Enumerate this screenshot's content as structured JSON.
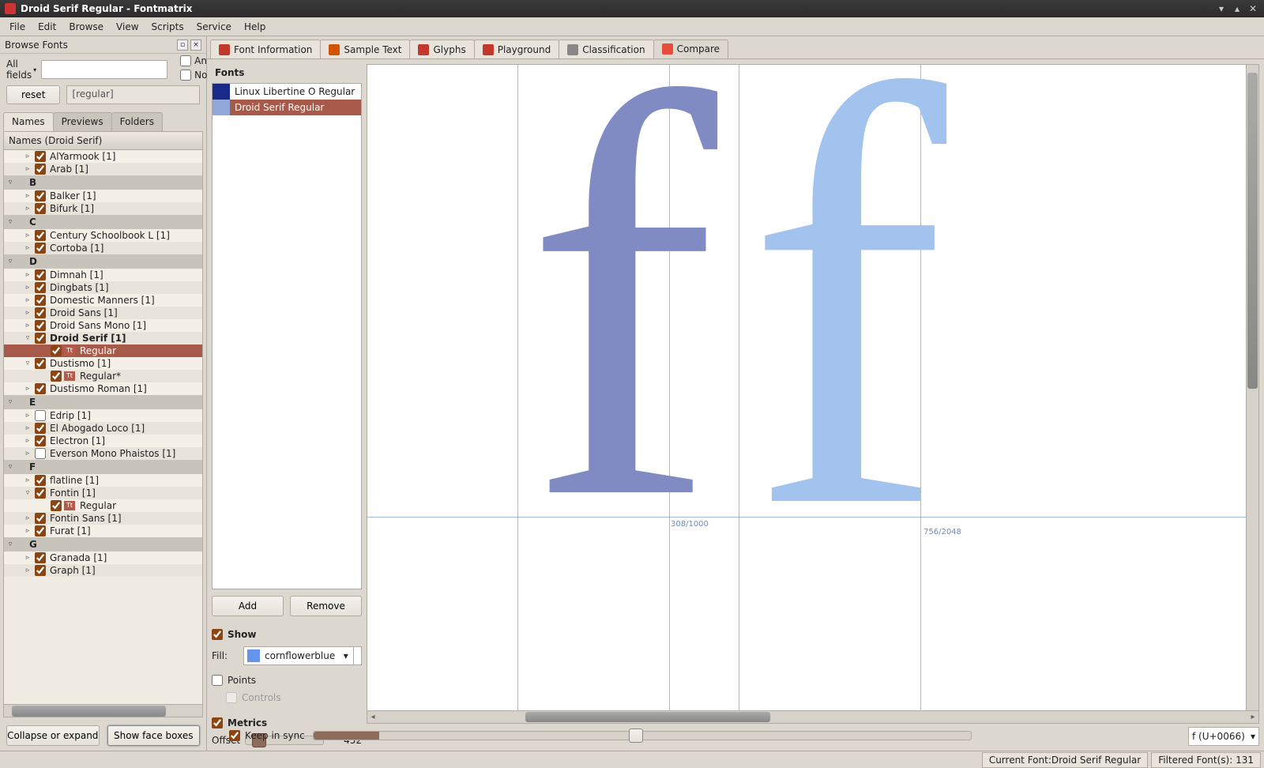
{
  "window": {
    "title": "Droid Serif Regular - Fontmatrix"
  },
  "menubar": [
    "File",
    "Edit",
    "Browse",
    "View",
    "Scripts",
    "Service",
    "Help"
  ],
  "browse": {
    "header": "Browse Fonts",
    "search_label": "All fields",
    "and": "And",
    "not": "Not",
    "reset": "reset",
    "filter_expr": "[regular]"
  },
  "sidetabs": {
    "names": "Names",
    "previews": "Previews",
    "folders": "Folders"
  },
  "tree": {
    "header": "Names (Droid Serif)",
    "rows": [
      {
        "t": "item",
        "i": 1,
        "cb": true,
        "label": "AlYarmook  [1]",
        "exp": "▹"
      },
      {
        "t": "item",
        "i": 1,
        "cb": true,
        "label": "Arab  [1]",
        "exp": "▹"
      },
      {
        "t": "group",
        "letter": "B"
      },
      {
        "t": "item",
        "i": 1,
        "cb": true,
        "label": "Balker  [1]",
        "exp": "▹"
      },
      {
        "t": "item",
        "i": 1,
        "cb": true,
        "label": "Bifurk  [1]",
        "exp": "▹"
      },
      {
        "t": "group",
        "letter": "C"
      },
      {
        "t": "item",
        "i": 1,
        "cb": true,
        "label": "Century Schoolbook L  [1]",
        "exp": "▹"
      },
      {
        "t": "item",
        "i": 1,
        "cb": true,
        "label": "Cortoba  [1]",
        "exp": "▹"
      },
      {
        "t": "group",
        "letter": "D"
      },
      {
        "t": "item",
        "i": 1,
        "cb": true,
        "label": "Dimnah  [1]",
        "exp": "▹"
      },
      {
        "t": "item",
        "i": 1,
        "cb": true,
        "label": "Dingbats  [1]",
        "exp": "▹"
      },
      {
        "t": "item",
        "i": 1,
        "cb": true,
        "label": "Domestic Manners  [1]",
        "exp": "▹"
      },
      {
        "t": "item",
        "i": 1,
        "cb": true,
        "label": "Droid Sans  [1]",
        "exp": "▹"
      },
      {
        "t": "item",
        "i": 1,
        "cb": true,
        "label": "Droid Sans Mono  [1]",
        "exp": "▹"
      },
      {
        "t": "item",
        "i": 1,
        "cb": true,
        "label": "Droid Serif  [1]",
        "exp": "▿",
        "bold": true
      },
      {
        "t": "face",
        "i": 2,
        "cb": true,
        "label": "Regular",
        "tt": true,
        "sel": true
      },
      {
        "t": "item",
        "i": 1,
        "cb": true,
        "label": "Dustismo  [1]",
        "exp": "▿"
      },
      {
        "t": "face",
        "i": 2,
        "cb": true,
        "label": "Regular*",
        "tt": true
      },
      {
        "t": "item",
        "i": 1,
        "cb": true,
        "label": "Dustismo Roman  [1]",
        "exp": "▹"
      },
      {
        "t": "group",
        "letter": "E"
      },
      {
        "t": "item",
        "i": 1,
        "cb": false,
        "label": "Edrip  [1]",
        "exp": "▹"
      },
      {
        "t": "item",
        "i": 1,
        "cb": true,
        "label": "El Abogado Loco  [1]",
        "exp": "▹"
      },
      {
        "t": "item",
        "i": 1,
        "cb": true,
        "label": "Electron  [1]",
        "exp": "▹"
      },
      {
        "t": "item",
        "i": 1,
        "cb": false,
        "label": "Everson Mono Phaistos  [1]",
        "exp": "▹"
      },
      {
        "t": "group",
        "letter": "F"
      },
      {
        "t": "item",
        "i": 1,
        "cb": true,
        "label": "flatline  [1]",
        "exp": "▹"
      },
      {
        "t": "item",
        "i": 1,
        "cb": true,
        "label": "Fontin  [1]",
        "exp": "▿"
      },
      {
        "t": "face",
        "i": 2,
        "cb": true,
        "label": "Regular",
        "tt": true
      },
      {
        "t": "item",
        "i": 1,
        "cb": true,
        "label": "Fontin Sans  [1]",
        "exp": "▹"
      },
      {
        "t": "item",
        "i": 1,
        "cb": true,
        "label": "Furat  [1]",
        "exp": "▹"
      },
      {
        "t": "group",
        "letter": "G"
      },
      {
        "t": "item",
        "i": 1,
        "cb": true,
        "label": "Granada  [1]",
        "exp": "▹"
      },
      {
        "t": "item",
        "i": 1,
        "cb": true,
        "label": "Graph  [1]",
        "exp": "▹"
      }
    ]
  },
  "left_actions": {
    "collapse": "Collapse or expand",
    "faceboxes": "Show face boxes"
  },
  "main_tabs": {
    "font_info": "Font Information",
    "sample": "Sample Text",
    "glyphs": "Glyphs",
    "playground": "Playground",
    "classification": "Classification",
    "compare": "Compare"
  },
  "compare": {
    "fonts_hdr": "Fonts",
    "list": [
      {
        "name": "Linux Libertine O Regular",
        "swatch": "#1a2a8a",
        "sel": false
      },
      {
        "name": "Droid Serif Regular",
        "swatch": "#8fa8d8",
        "sel": true
      }
    ],
    "add": "Add",
    "remove": "Remove",
    "show": "Show",
    "fill_lbl": "Fill:",
    "fill_name": "cornflowerblue",
    "fill_color": "#6495ed",
    "points": "Points",
    "controls": "Controls",
    "metrics": "Metrics",
    "offset_lbl": "Offset",
    "offset_val": "452",
    "sync": "Keep in sync",
    "metric_label_1": "308/1000",
    "metric_label_2": "756/2048",
    "glyph_selector": "f (U+0066)"
  },
  "status": {
    "current": "Current Font:Droid Serif Regular",
    "filtered": "Filtered Font(s): 131"
  }
}
